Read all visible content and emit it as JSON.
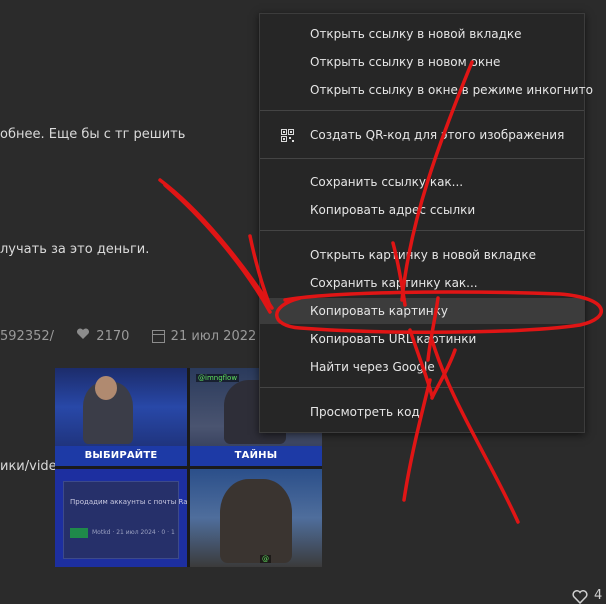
{
  "background_text": {
    "line1": "обнее. Еще бы с тг решить",
    "line2": "лучать за это деньги.",
    "line3": "ики/video"
  },
  "meta": {
    "link_fragment": "592352/",
    "likes": "2170",
    "date": "21 июл 2022"
  },
  "bottom_right_count": "4",
  "meme": {
    "caption_left": "ВЫБИРАЙТЕ КАТЕГОРИЮ",
    "caption_right": "ТАЙНЫ ЧЕЛОВЕЧЕСТВА",
    "card_text": "Продадим аккаунты с почты Rambler",
    "card_meta": "Motkd · 21 июл 2024 · 0 · 1",
    "card_badge": "Маркет",
    "watermark": "@imngflow"
  },
  "context_menu": {
    "open_new_tab": "Открыть ссылку в новой вкладке",
    "open_new_window": "Открыть ссылку в новом окне",
    "open_incognito": "Открыть ссылку в окне в режиме инкогнито",
    "create_qr": "Создать QR-код для этого изображения",
    "save_link_as": "Сохранить ссылку как...",
    "copy_link_address": "Копировать адрес ссылки",
    "open_image_new_tab": "Открыть картинку в новой вкладке",
    "save_image_as": "Сохранить картинку как...",
    "copy_image": "Копировать картинку",
    "copy_image_url": "Копировать URL картинки",
    "search_google": "Найти через Google",
    "inspect": "Просмотреть код"
  },
  "colors": {
    "background": "#2b2b2b",
    "menu_background": "#262626",
    "menu_highlight": "#3c3c3c",
    "annotation_red": "#e01515"
  }
}
